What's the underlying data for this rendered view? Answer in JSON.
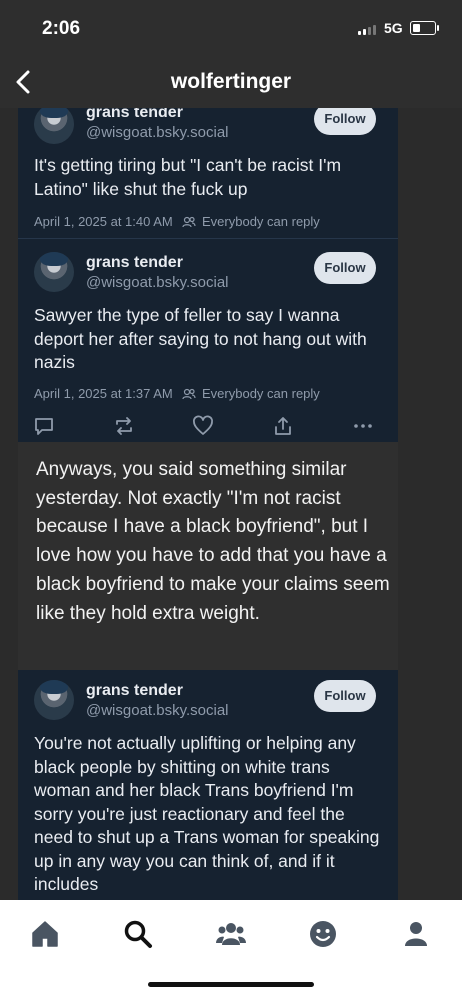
{
  "status_bar": {
    "time": "2:06",
    "network": "5G",
    "battery_level": 0.35
  },
  "header": {
    "title": "wolfertinger",
    "back_icon": "chevron-left-icon"
  },
  "posts": [
    {
      "display_name": "grans tender",
      "handle": "@wisgoat.bsky.social",
      "follow_label": "Follow",
      "text": "It's getting tiring but \"I can't be racist I'm Latino\" like shut the fuck up",
      "date": "April 1, 2025 at 1:40 AM",
      "reply_setting": "Everybody can reply"
    },
    {
      "display_name": "grans tender",
      "handle": "@wisgoat.bsky.social",
      "follow_label": "Follow",
      "text": "Sawyer the type of feller to say I wanna deport her after saying to not hang out with nazis",
      "date": "April 1, 2025 at 1:37 AM",
      "reply_setting": "Everybody can reply",
      "actions": [
        "comment-icon",
        "repost-icon",
        "heart-icon",
        "share-icon",
        "more-icon"
      ]
    },
    {
      "display_name": "grans tender",
      "handle": "@wisgoat.bsky.social",
      "follow_label": "Follow",
      "text": "You're not actually uplifting or helping any black people by shitting on white trans woman and her black Trans boyfriend I'm sorry you're just reactionary and feel the need to shut up a Trans woman for speaking up in any way you can think of, and if it includes"
    }
  ],
  "paragraph": "Anyways, you said something similar yesterday. Not exactly \"I'm not racist because I have a black boyfriend\", but I love how you have to add that you have a black boyfriend to make your claims seem like they hold extra weight.",
  "bottom_nav": {
    "items": [
      "home-icon",
      "search-icon",
      "community-icon",
      "smiley-icon",
      "profile-icon"
    ],
    "active": "search-icon"
  },
  "colors": {
    "post_bg": "#162230",
    "page_bg": "#2b2b2b",
    "follow_bg": "#dfe5ec",
    "nav_icon": "#4a5562"
  }
}
